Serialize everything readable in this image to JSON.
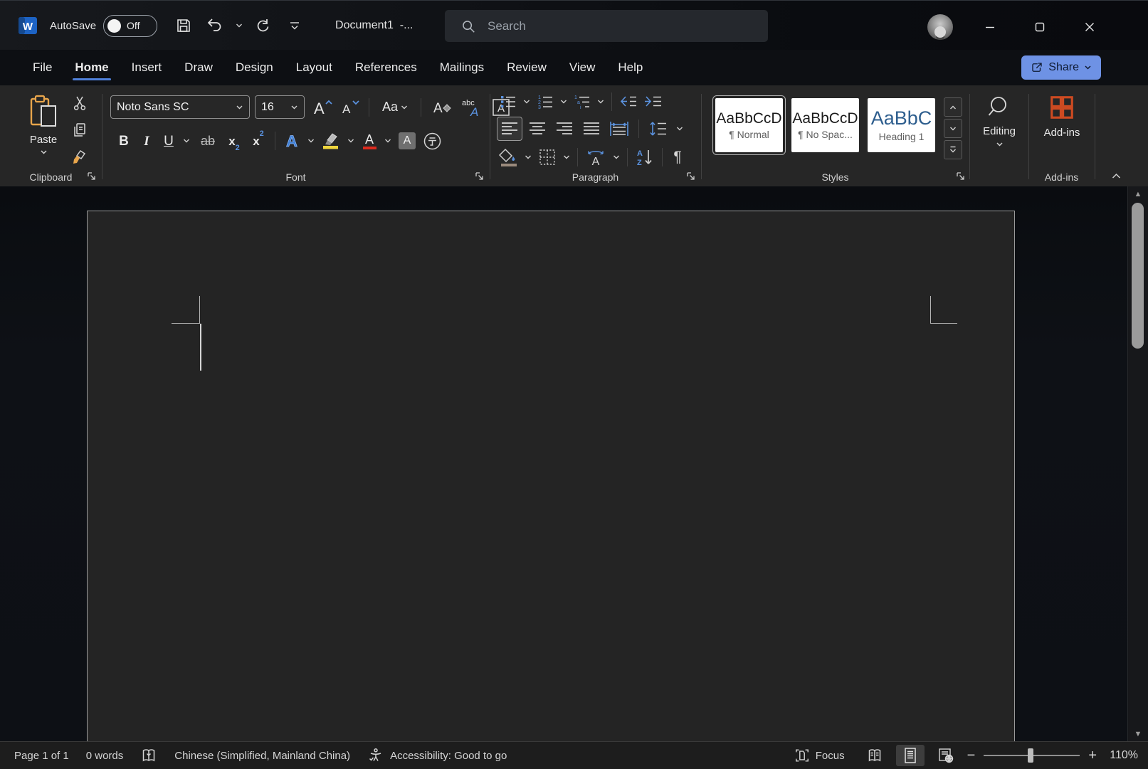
{
  "titlebar": {
    "autosave_label": "AutoSave",
    "autosave_state": "Off",
    "document_title": "Document1  -...",
    "search_placeholder": "Search"
  },
  "tabs": [
    {
      "label": "File"
    },
    {
      "label": "Home",
      "active": true
    },
    {
      "label": "Insert"
    },
    {
      "label": "Draw"
    },
    {
      "label": "Design"
    },
    {
      "label": "Layout"
    },
    {
      "label": "References"
    },
    {
      "label": "Mailings"
    },
    {
      "label": "Review"
    },
    {
      "label": "View"
    },
    {
      "label": "Help"
    }
  ],
  "share": {
    "label": "Share"
  },
  "ribbon": {
    "clipboard": {
      "group_label": "Clipboard",
      "paste_label": "Paste"
    },
    "font": {
      "group_label": "Font",
      "family": "Noto Sans SC",
      "size": "16",
      "bold": "B",
      "italic": "I",
      "underline": "U",
      "strikethrough": "ab",
      "sub_base": "x",
      "sub_digit": "2",
      "sup_base": "x",
      "sup_digit": "2",
      "change_case": "Aa",
      "effects_letter": "A",
      "font_color_letter": "A",
      "shading_letter": "A"
    },
    "paragraph": {
      "group_label": "Paragraph",
      "pilcrow": "¶",
      "sort_a": "A",
      "sort_z": "Z",
      "asian_letter": "A"
    },
    "styles": {
      "group_label": "Styles",
      "cards": [
        {
          "sample": "AaBbCcD",
          "name": "¶ Normal",
          "selected": true
        },
        {
          "sample": "AaBbCcD",
          "name": "¶ No Spac..."
        },
        {
          "sample": "AaBbC",
          "name": "Heading 1"
        }
      ]
    },
    "editing": {
      "button_label": "Editing"
    },
    "addins": {
      "button_label": "Add-ins",
      "group_label": "Add-ins"
    }
  },
  "statusbar": {
    "page": "Page 1 of 1",
    "words": "0 words",
    "language": "Chinese (Simplified, Mainland China)",
    "accessibility": "Accessibility: Good to go",
    "focus_label": "Focus",
    "zoom_out": "−",
    "zoom_in": "+",
    "zoom_level": "110%"
  },
  "colors": {
    "share_button": "#6e92e5",
    "active_tab_underline": "#4f80d9",
    "heading_blue": "#2e5e8e",
    "highlight_yellow": "#efd63d",
    "font_color_red": "#dd2b1e",
    "paste_orange": "#e8a54b",
    "addins_red": "#cc4a21",
    "list_accent_blue": "#5b93e0",
    "page_background": "#242424",
    "ribbon_background": "#262626"
  }
}
